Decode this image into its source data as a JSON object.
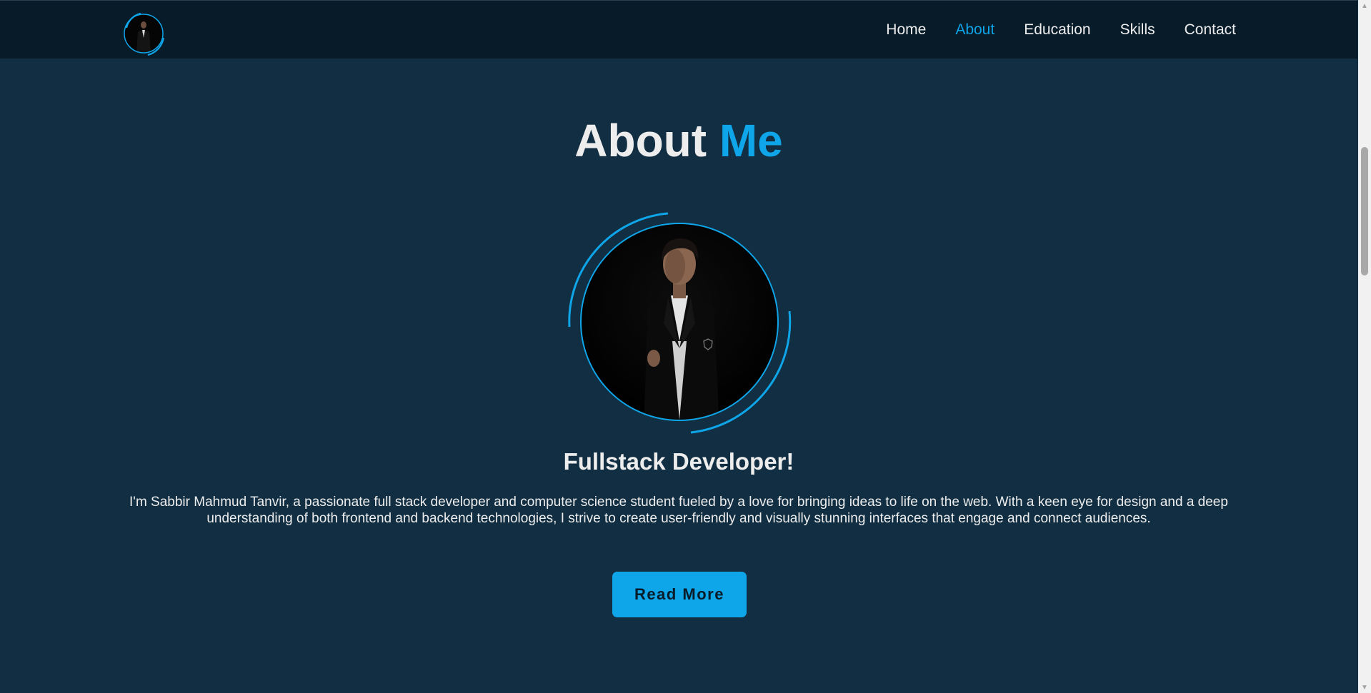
{
  "nav": {
    "items": [
      {
        "label": "Home",
        "active": false
      },
      {
        "label": "About",
        "active": true
      },
      {
        "label": "Education",
        "active": false
      },
      {
        "label": "Skills",
        "active": false
      },
      {
        "label": "Contact",
        "active": false
      }
    ]
  },
  "about": {
    "title_main": "About",
    "title_accent": "Me",
    "subtitle": "Fullstack Developer!",
    "description": "I'm Sabbir Mahmud Tanvir, a passionate full stack developer and computer science student fueled by a love for bringing ideas to life on the web. With a keen eye for design and a deep understanding of both frontend and backend technologies, I strive to create user-friendly and visually stunning interfaces that engage and connect audiences.",
    "button_label": "Read More"
  },
  "colors": {
    "background": "#112e42",
    "header": "#081b29",
    "accent": "#0ea5e9",
    "text": "#ededed"
  }
}
